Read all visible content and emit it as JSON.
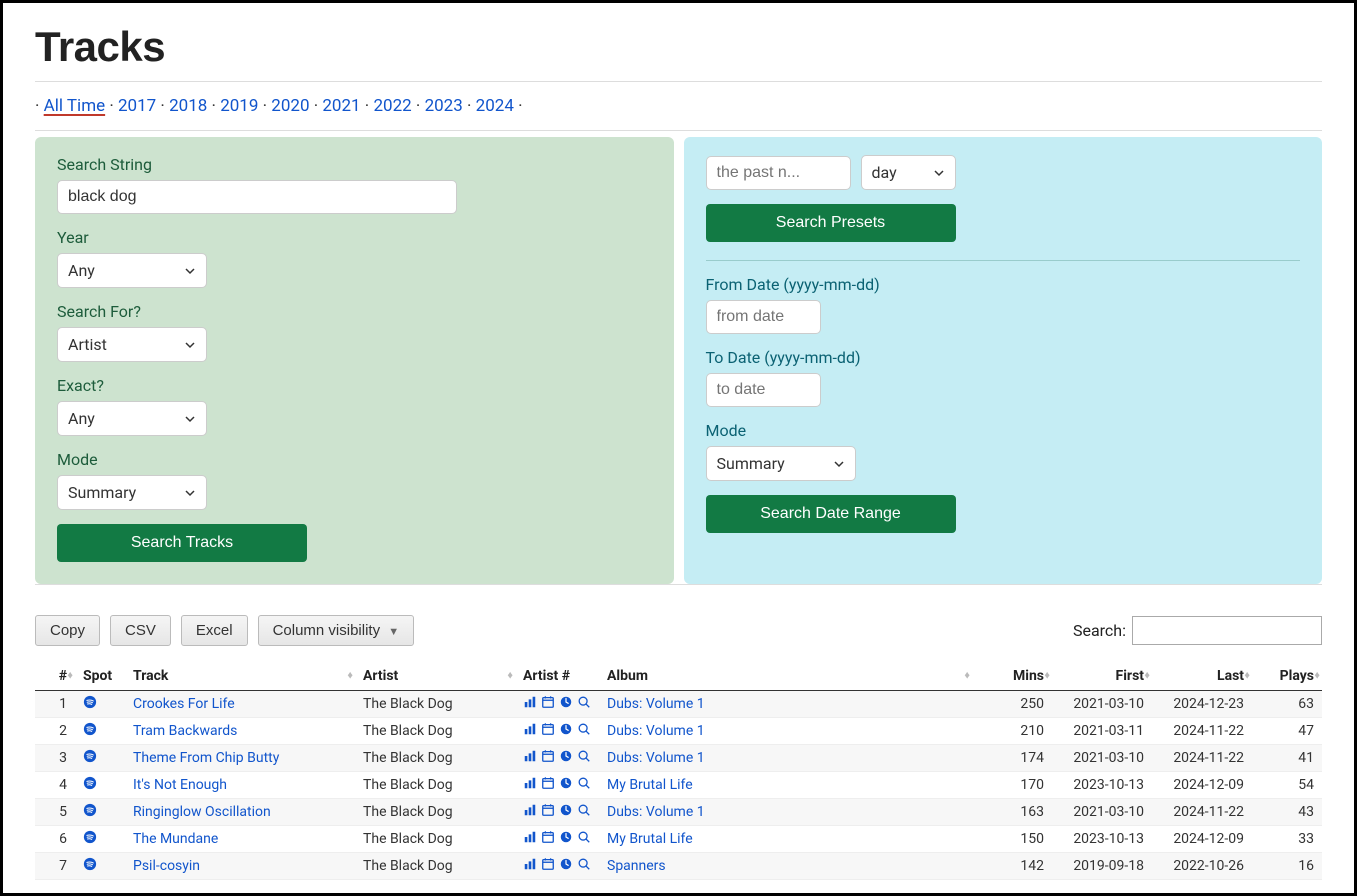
{
  "title": "Tracks",
  "years": {
    "active": "All Time",
    "items": [
      "All Time",
      "2017",
      "2018",
      "2019",
      "2020",
      "2021",
      "2022",
      "2023",
      "2024"
    ]
  },
  "left_form": {
    "search_string_label": "Search String",
    "search_string_value": "black dog",
    "year_label": "Year",
    "year_value": "Any",
    "search_for_label": "Search For?",
    "search_for_value": "Artist",
    "exact_label": "Exact?",
    "exact_value": "Any",
    "mode_label": "Mode",
    "mode_value": "Summary",
    "submit_label": "Search Tracks"
  },
  "right_form": {
    "preset_n_placeholder": "the past n...",
    "preset_unit_value": "day",
    "presets_button": "Search Presets",
    "from_label": "From Date (yyyy-mm-dd)",
    "from_placeholder": "from date",
    "to_label": "To Date (yyyy-mm-dd)",
    "to_placeholder": "to date",
    "mode_label": "Mode",
    "mode_value": "Summary",
    "submit_label": "Search Date Range"
  },
  "toolbar": {
    "copy": "Copy",
    "csv": "CSV",
    "excel": "Excel",
    "colvis": "Column visibility",
    "search_label": "Search:"
  },
  "table": {
    "headers": {
      "idx": "#",
      "spot": "Spot",
      "track": "Track",
      "artist": "Artist",
      "artist_num": "Artist #",
      "album": "Album",
      "mins": "Mins",
      "first": "First",
      "last": "Last",
      "plays": "Plays"
    },
    "rows": [
      {
        "idx": 1,
        "track": "Crookes For Life",
        "artist": "The Black Dog",
        "album": "Dubs: Volume 1",
        "mins": 250,
        "first": "2021-03-10",
        "last": "2024-12-23",
        "plays": 63
      },
      {
        "idx": 2,
        "track": "Tram Backwards",
        "artist": "The Black Dog",
        "album": "Dubs: Volume 1",
        "mins": 210,
        "first": "2021-03-11",
        "last": "2024-11-22",
        "plays": 47
      },
      {
        "idx": 3,
        "track": "Theme From Chip Butty",
        "artist": "The Black Dog",
        "album": "Dubs: Volume 1",
        "mins": 174,
        "first": "2021-03-10",
        "last": "2024-11-22",
        "plays": 41
      },
      {
        "idx": 4,
        "track": "It's Not Enough",
        "artist": "The Black Dog",
        "album": "My Brutal Life",
        "mins": 170,
        "first": "2023-10-13",
        "last": "2024-12-09",
        "plays": 54
      },
      {
        "idx": 5,
        "track": "Ringinglow Oscillation",
        "artist": "The Black Dog",
        "album": "Dubs: Volume 1",
        "mins": 163,
        "first": "2021-03-10",
        "last": "2024-11-22",
        "plays": 43
      },
      {
        "idx": 6,
        "track": "The Mundane",
        "artist": "The Black Dog",
        "album": "My Brutal Life",
        "mins": 150,
        "first": "2023-10-13",
        "last": "2024-12-09",
        "plays": 33
      },
      {
        "idx": 7,
        "track": "Psil-cosyin",
        "artist": "The Black Dog",
        "album": "Spanners",
        "mins": 142,
        "first": "2019-09-18",
        "last": "2022-10-26",
        "plays": 16
      }
    ]
  },
  "colors": {
    "green_panel": "#cde3cf",
    "blue_panel": "#c5edf4",
    "button_green": "#127a44",
    "link_blue": "#1155cc",
    "icon_blue": "#1155cc"
  }
}
